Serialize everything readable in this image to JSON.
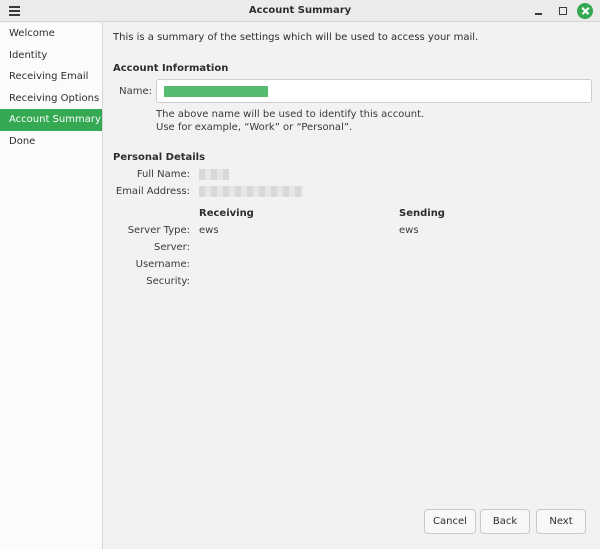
{
  "window": {
    "title": "Account Summary",
    "menu_icon": "hamburger-icon"
  },
  "sidebar": {
    "items": [
      {
        "label": "Welcome",
        "active": false
      },
      {
        "label": "Identity",
        "active": false
      },
      {
        "label": "Receiving Email",
        "active": false
      },
      {
        "label": "Receiving Options",
        "active": false
      },
      {
        "label": "Account Summary",
        "active": true
      },
      {
        "label": "Done",
        "active": false
      }
    ]
  },
  "main": {
    "intro": "This is a summary of the settings which will be used to access your mail.",
    "account_info": {
      "title": "Account Information",
      "name_label": "Name:",
      "hint_line1": "The above name will be used to identify this account.",
      "hint_line2": "Use for example, “Work” or “Personal”."
    },
    "personal": {
      "title": "Personal Details",
      "full_name_label": "Full Name:",
      "email_label": "Email Address:"
    },
    "servers": {
      "receiving_header": "Receiving",
      "sending_header": "Sending",
      "server_type_label": "Server Type:",
      "server_label": "Server:",
      "username_label": "Username:",
      "security_label": "Security:",
      "receiving_type": "ews",
      "sending_type": "ews"
    }
  },
  "buttons": {
    "cancel": "Cancel",
    "back": "Back",
    "next": "Next"
  },
  "colors": {
    "accent": "#35a852",
    "background": "#f2f2f2",
    "sidebar": "#fbfbfb"
  }
}
